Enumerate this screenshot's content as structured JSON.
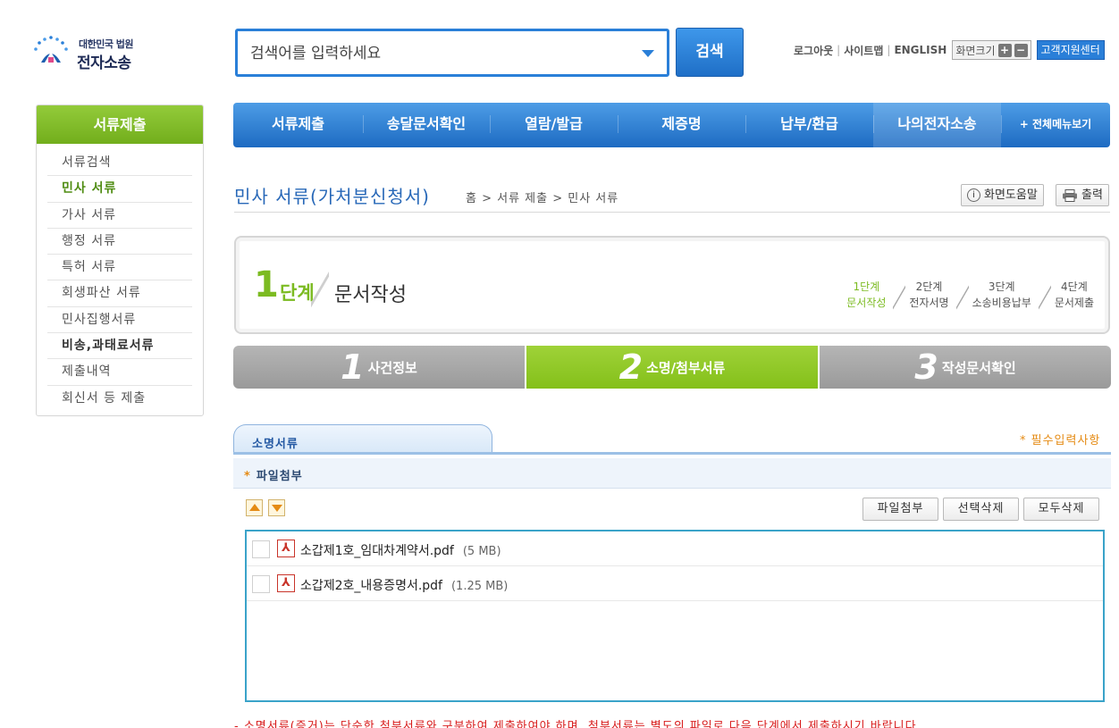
{
  "header": {
    "logo_line1": "대한민국 법원",
    "logo_line2": "전자소송",
    "search_placeholder": "검색어를 입력하세요",
    "search_button": "검색",
    "utility": {
      "logout": "로그아웃",
      "sitemap": "사이트맵",
      "english": "ENGLISH",
      "font_size": "화면크기",
      "plus": "+",
      "minus": "−",
      "customer_center": "고객지원센터"
    }
  },
  "gnb": {
    "items": [
      "서류제출",
      "송달문서확인",
      "열람/발급",
      "제증명",
      "납부/환급",
      "나의전자소송",
      "+ 전체메뉴보기"
    ]
  },
  "sidebar": {
    "title": "서류제출",
    "items": [
      {
        "label": "서류검색"
      },
      {
        "label": "민사 서류"
      },
      {
        "label": "가사 서류"
      },
      {
        "label": "행정 서류"
      },
      {
        "label": "특허 서류"
      },
      {
        "label": "회생파산 서류"
      },
      {
        "label": "민사집행서류"
      },
      {
        "label": "비송,과태료서류"
      },
      {
        "label": "제출내역"
      },
      {
        "label": "회신서 등 제출"
      }
    ]
  },
  "page": {
    "title": "민사 서류(가처분신청서)",
    "breadcrumb": "홈 > 서류 제출 > 민사 서류",
    "help_button": "화면도움말",
    "help_icon_glyph": "i",
    "print_button": "출력"
  },
  "stepbox": {
    "number": "1",
    "label": "단계",
    "name": "문서작성",
    "steps": [
      {
        "top": "1단계",
        "bottom": "문서작성"
      },
      {
        "top": "2단계",
        "bottom": "전자서명"
      },
      {
        "top": "3단계",
        "bottom": "소송비용납부"
      },
      {
        "top": "4단계",
        "bottom": "문서제출"
      }
    ]
  },
  "subtabs": [
    {
      "num": "1",
      "label": "사건정보"
    },
    {
      "num": "2",
      "label": "소명/첨부서류"
    },
    {
      "num": "3",
      "label": "작성문서확인"
    }
  ],
  "section": {
    "tab_label": "소명서류",
    "required_note": "* 필수입력사항",
    "attach_star": "*",
    "attach_title": "파일첨부",
    "buttons": {
      "attach": "파일첨부",
      "delete_selected": "선택삭제",
      "delete_all": "모두삭제"
    },
    "files": [
      {
        "name": "소갑제1호_임대차계약서.pdf",
        "size": "(5 MB)"
      },
      {
        "name": "소갑제2호_내용증명서.pdf",
        "size": "(1.25 MB)"
      }
    ],
    "notice": "- 소명서류(증거)는 단순한 첨부서류와 구분하여 제출하여야 하며, 첨부서류는 별도의 파일로 다음 단계에서 제출하시기 바랍니다."
  },
  "colors": {
    "brand_blue": "#2a7fd8",
    "brand_green": "#84c01a",
    "accent_orange": "#e58b14",
    "notice_red": "#d81c1c"
  }
}
